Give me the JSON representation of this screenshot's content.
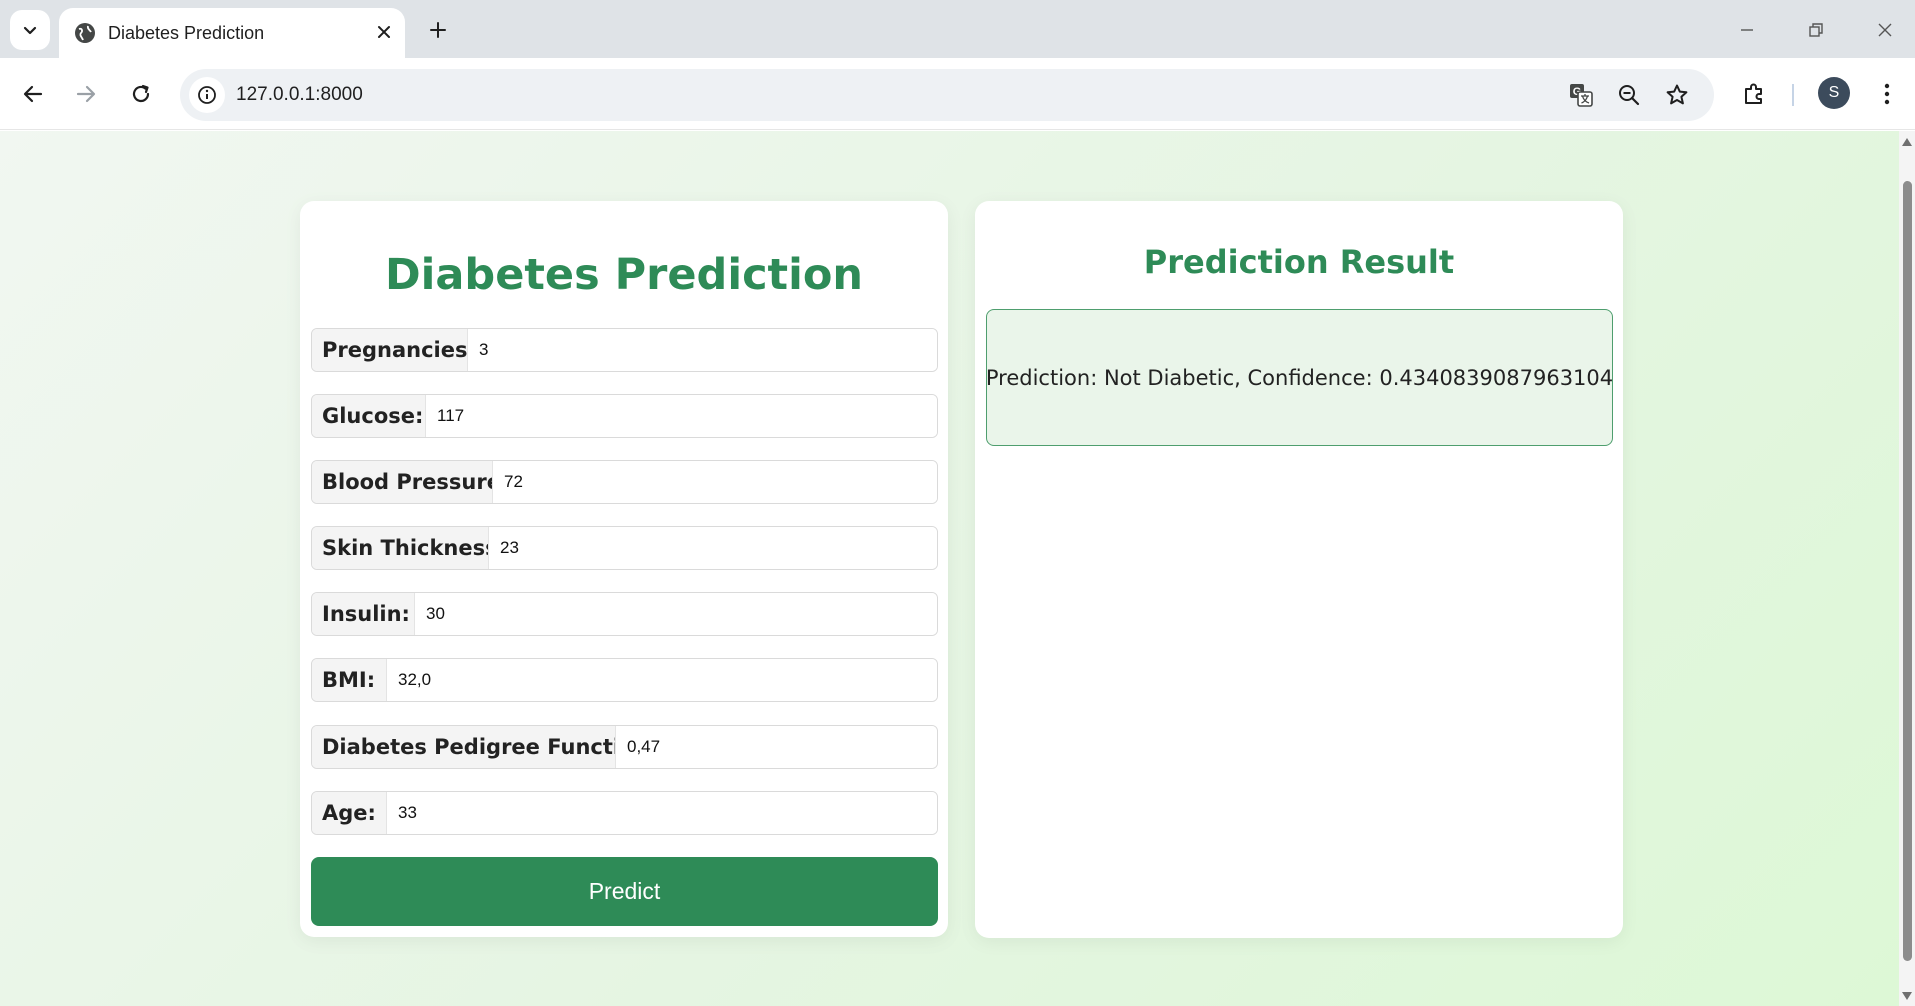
{
  "browser": {
    "tab_title": "Diabetes Prediction",
    "url": "127.0.0.1:8000",
    "profile_initial": "S"
  },
  "form": {
    "title": "Diabetes Prediction",
    "fields": [
      {
        "label": "Pregnancies:",
        "value": "3"
      },
      {
        "label": "Glucose:",
        "value": "117"
      },
      {
        "label": "Blood Pressure:",
        "value": "72"
      },
      {
        "label": "Skin Thickness:",
        "value": "23"
      },
      {
        "label": "Insulin:",
        "value": "30"
      },
      {
        "label": "BMI:",
        "value": "32,0"
      },
      {
        "label": "Diabetes Pedigree Function:",
        "value": "0,47"
      },
      {
        "label": "Age:",
        "value": "33"
      }
    ],
    "submit_label": "Predict"
  },
  "result": {
    "title": "Prediction Result",
    "text": "Prediction: Not Diabetic, Confidence: 0.4340839087963104"
  },
  "colors": {
    "accent": "#2e8b57",
    "result_bg": "#eaf5ea",
    "result_border": "#4e9e6e"
  }
}
